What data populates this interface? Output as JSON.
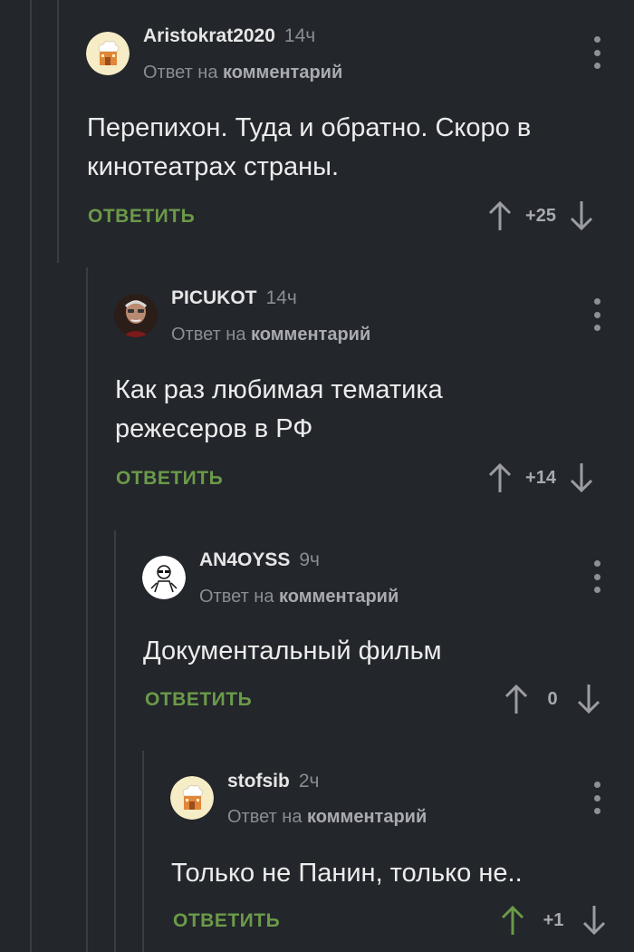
{
  "comments": [
    {
      "author": "Aristokrat2020",
      "time": "14ч",
      "reply_prefix": "Ответ на",
      "reply_target": "комментарий",
      "text": "Перепихон. Туда и обратно. Скоро в кинотеатрах страны.",
      "reply_label": "ОТВЕТИТЬ",
      "score": "+25",
      "avatar_icon": "chef-hat-house-avatar"
    },
    {
      "author": "PICUKOT",
      "time": "14ч",
      "reply_prefix": "Ответ на",
      "reply_target": "комментарий",
      "text": "Как раз любимая тематика режесеров в РФ",
      "reply_label": "ОТВЕТИТЬ",
      "score": "+14",
      "avatar_icon": "elderly-man-photo-avatar"
    },
    {
      "author": "AN4OYSS",
      "time": "9ч",
      "reply_prefix": "Ответ на",
      "reply_target": "комментарий",
      "text": "Документальный фильм",
      "reply_label": "ОТВЕТИТЬ",
      "score": "0",
      "avatar_icon": "sketch-figure-avatar"
    },
    {
      "author": "stofsib",
      "time": "2ч",
      "reply_prefix": "Ответ на",
      "reply_target": "комментарий",
      "text": "Только не Панин, только не..",
      "reply_label": "ОТВЕТИТЬ",
      "score": "+1",
      "avatar_icon": "chef-hat-house-avatar",
      "upvoted": true
    }
  ],
  "colors": {
    "background": "#23262b",
    "accent_green": "#6b9a49",
    "muted": "#8a8d92",
    "thread_line": "#3a3d43"
  }
}
